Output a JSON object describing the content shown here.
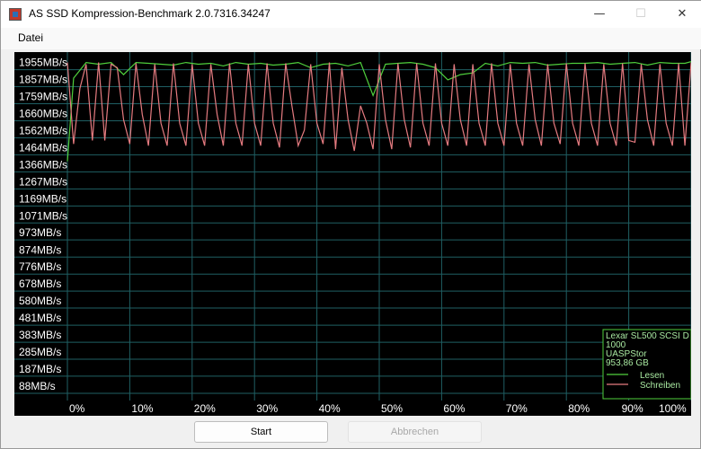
{
  "window": {
    "title": "AS SSD Kompression-Benchmark 2.0.7316.34247",
    "minimize_glyph": "—",
    "maximize_glyph": "☐",
    "close_glyph": "✕"
  },
  "menu": {
    "items": [
      "Datei"
    ]
  },
  "chart_data": {
    "type": "line",
    "ylabels": [
      "1955MB/s",
      "1857MB/s",
      "1759MB/s",
      "1660MB/s",
      "1562MB/s",
      "1464MB/s",
      "1366MB/s",
      "1267MB/s",
      "1169MB/s",
      "1071MB/s",
      "973MB/s",
      "874MB/s",
      "776MB/s",
      "678MB/s",
      "580MB/s",
      "481MB/s",
      "383MB/s",
      "285MB/s",
      "187MB/s",
      "88MB/s"
    ],
    "xlabels": [
      "0%",
      "10%",
      "20%",
      "30%",
      "40%",
      "50%",
      "60%",
      "70%",
      "80%",
      "90%",
      "100%"
    ],
    "ylim": [
      0,
      2010
    ],
    "grid": true,
    "legend_position": "bottom-right",
    "legend_header": [
      "Lexar SL500 SCSI D",
      "1000",
      "UASPStor",
      "953,86 GB"
    ],
    "series": [
      {
        "name": "Lesen",
        "color": "#4fcf3c",
        "x": [
          0,
          1,
          3,
          5,
          7,
          9,
          11,
          13,
          15,
          17,
          19,
          21,
          23,
          25,
          27,
          29,
          31,
          33,
          35,
          37,
          39,
          41,
          43,
          45,
          47,
          49,
          51,
          53,
          55,
          57,
          59,
          61,
          63,
          65,
          67,
          69,
          71,
          73,
          75,
          77,
          79,
          81,
          83,
          85,
          87,
          89,
          91,
          93,
          95,
          97,
          99,
          100
        ],
        "y": [
          1380,
          1860,
          1950,
          1940,
          1950,
          1880,
          1950,
          1945,
          1940,
          1935,
          1950,
          1940,
          1945,
          1930,
          1950,
          1940,
          1945,
          1935,
          1940,
          1950,
          1920,
          1940,
          1945,
          1930,
          1950,
          1760,
          1940,
          1945,
          1950,
          1940,
          1920,
          1850,
          1880,
          1890,
          1945,
          1930,
          1950,
          1945,
          1950,
          1935,
          1940,
          1945,
          1945,
          1950,
          1940,
          1945,
          1950,
          1935,
          1950,
          1945,
          1945,
          1955
        ]
      },
      {
        "name": "Schreiben",
        "color": "#e57b80",
        "x": [
          0,
          1,
          2,
          3,
          4,
          5,
          6,
          7,
          8,
          9,
          10,
          11,
          12,
          13,
          14,
          15,
          16,
          17,
          18,
          19,
          20,
          21,
          22,
          23,
          24,
          25,
          26,
          27,
          28,
          29,
          30,
          31,
          32,
          33,
          34,
          35,
          36,
          37,
          38,
          39,
          40,
          41,
          42,
          43,
          44,
          45,
          46,
          47,
          48,
          49,
          50,
          51,
          52,
          53,
          54,
          55,
          56,
          57,
          58,
          59,
          60,
          61,
          62,
          63,
          64,
          65,
          66,
          67,
          68,
          69,
          70,
          71,
          72,
          73,
          74,
          75,
          76,
          77,
          78,
          79,
          80,
          81,
          82,
          83,
          84,
          85,
          86,
          87,
          88,
          89,
          90,
          91,
          92,
          93,
          94,
          95,
          96,
          97,
          98,
          99,
          100
        ],
        "y": [
          1950,
          1480,
          1800,
          1940,
          1500,
          1950,
          1500,
          1940,
          1920,
          1620,
          1480,
          1945,
          1650,
          1470,
          1940,
          1600,
          1470,
          1945,
          1600,
          1470,
          1940,
          1600,
          1470,
          1940,
          1650,
          1470,
          1945,
          1600,
          1470,
          1940,
          1600,
          1470,
          1945,
          1600,
          1460,
          1945,
          1700,
          1470,
          1560,
          1940,
          1600,
          1480,
          1950,
          1450,
          1920,
          1620,
          1440,
          1700,
          1600,
          1450,
          1940,
          1620,
          1450,
          1945,
          1620,
          1460,
          1945,
          1600,
          1470,
          1945,
          1600,
          1470,
          1940,
          1620,
          1470,
          1940,
          1600,
          1470,
          1945,
          1600,
          1470,
          1940,
          1600,
          1470,
          1940,
          1620,
          1470,
          1940,
          1600,
          1480,
          1945,
          1600,
          1470,
          1945,
          1600,
          1470,
          1940,
          1600,
          1470,
          1945,
          1500,
          1490,
          1940,
          1620,
          1470,
          1940,
          1600,
          1470,
          1945,
          1470,
          1950
        ]
      }
    ]
  },
  "buttons": {
    "start": "Start",
    "abort": "Abbrechen"
  }
}
